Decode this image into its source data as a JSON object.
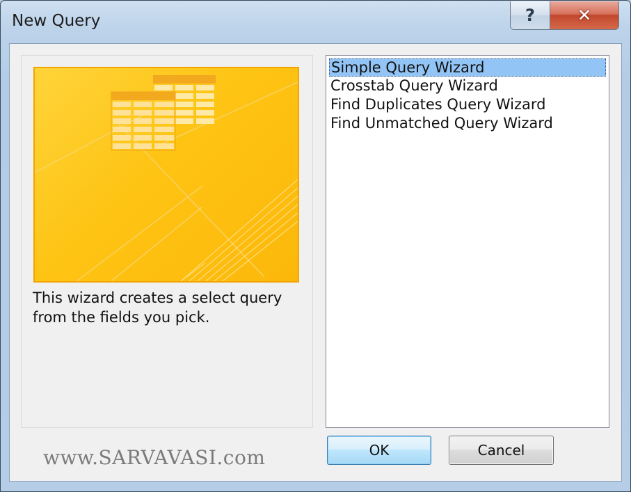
{
  "window": {
    "title": "New Query",
    "help_glyph": "?",
    "close_glyph": "✕"
  },
  "preview": {
    "description_line1": "This wizard creates a select query",
    "description_line2": "from the fields you pick."
  },
  "wizards": {
    "items": [
      {
        "label": "Simple Query Wizard",
        "selected": true
      },
      {
        "label": "Crosstab Query Wizard",
        "selected": false
      },
      {
        "label": "Find Duplicates Query Wizard",
        "selected": false
      },
      {
        "label": "Find Unmatched Query Wizard",
        "selected": false
      }
    ]
  },
  "buttons": {
    "ok_label": "OK",
    "cancel_label": "Cancel"
  },
  "watermark": "www.SARVAVASI.com",
  "colors": {
    "selection": "#92c5f6",
    "art_base": "#fec414",
    "close_button": "#c2472c"
  }
}
